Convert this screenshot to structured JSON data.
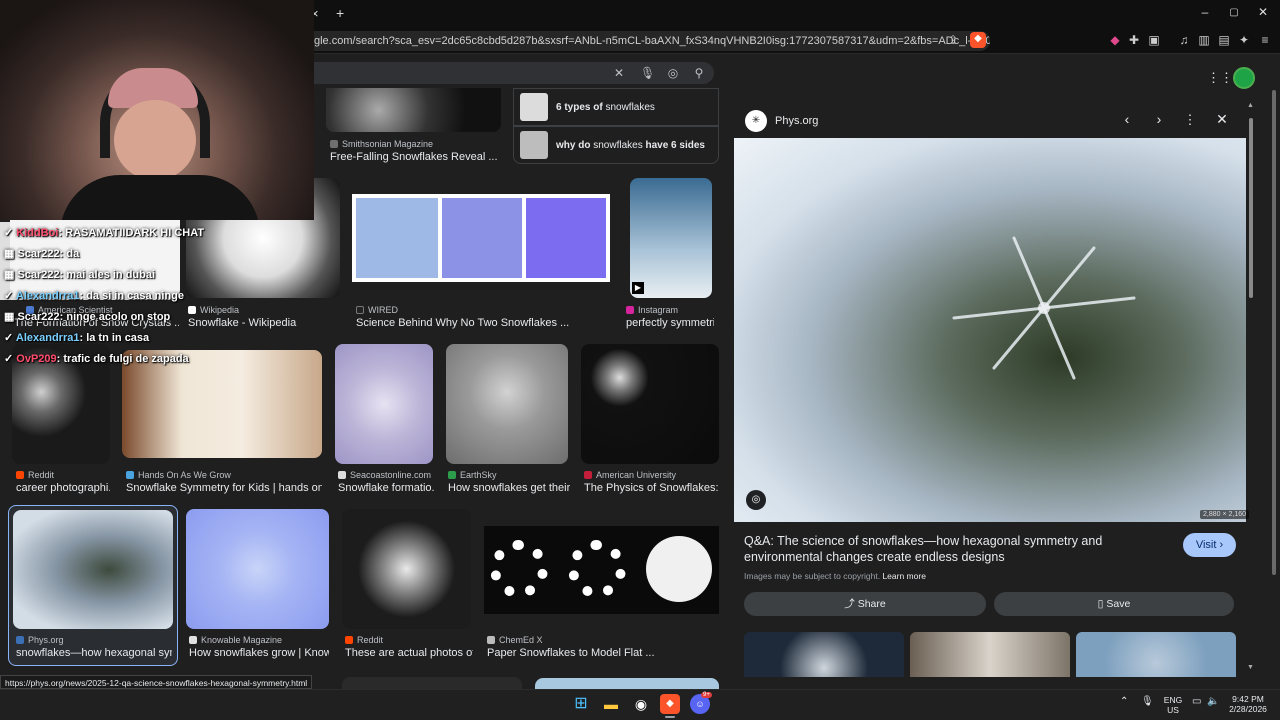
{
  "browser": {
    "tab_close": "×",
    "tab_new": "+",
    "url": "gle.com/search?sca_esv=2dc65c8cbd5d287b&sxsrf=ANbL-n5mCL-baAXN_fxS34nqVHNB2I0isg:1772307587317&udm=2&fbs=ADc_l-aN0CWEZBOHjof...",
    "window_controls": [
      "–",
      "▢",
      "✕"
    ]
  },
  "results": {
    "related": [
      {
        "bold_pre": "6 types of",
        "text": " snowflakes",
        "bold_post": ""
      },
      {
        "bold_pre": "why do",
        "text": " snowflakes ",
        "bold_post": "have 6 sides"
      }
    ],
    "items": [
      {
        "source": "Smithsonian Magazine",
        "caption": "Free-Falling Snowflakes Reveal ...",
        "fav": "#6f6f6f"
      },
      {
        "source": "American Scientist",
        "caption": "The Formation of Snow Crystals ...",
        "fav": "#4a7bd0"
      },
      {
        "source": "Wikipedia",
        "caption": "Snowflake - Wikipedia",
        "fav": "#ffffff"
      },
      {
        "source": "WIRED",
        "caption": "Science Behind Why No Two Snowflakes ...",
        "fav": "#222222"
      },
      {
        "source": "Instagram",
        "caption": "perfectly symmetri...",
        "fav": "#d6249f"
      },
      {
        "source": "Reddit",
        "caption": "career photographi...",
        "fav": "#ff4500"
      },
      {
        "source": "Hands On As We Grow",
        "caption": "Snowflake Symmetry for Kids | hands on ...",
        "fav": "#4aa3df"
      },
      {
        "source": "Seacoastonline.com",
        "caption": "Snowflake formatio...",
        "fav": "#dddddd"
      },
      {
        "source": "EarthSky",
        "caption": "How snowflakes get their...",
        "fav": "#2d9c4c"
      },
      {
        "source": "American University",
        "caption": "The Physics of Snowflakes: ...",
        "fav": "#c41e3a"
      },
      {
        "source": "Phys.org",
        "caption": "snowflakes—how hexagonal sym...",
        "fav": "#3b6fb6"
      },
      {
        "source": "Knowable Magazine",
        "caption": "How snowflakes grow | Know...",
        "fav": "#e0e0e0"
      },
      {
        "source": "Reddit",
        "caption": "These are actual photos of...",
        "fav": "#ff4500"
      },
      {
        "source": "ChemEd X",
        "caption": "Paper Snowflakes to Model Flat ...",
        "fav": "#bbbbbb"
      }
    ]
  },
  "chat": [
    {
      "user": "KiddBoi",
      "msg": ": RASAMATIIDARK HI CHAT",
      "ucolor": "#ff4d6d"
    },
    {
      "user": "Scar222",
      "msg": ": da",
      "ucolor": "#e8eaed"
    },
    {
      "user": "Scar222",
      "msg": ": mai ales in dubai",
      "ucolor": "#e8eaed"
    },
    {
      "user": "Alexandrra1",
      "msg": ": da si in casa ninge",
      "ucolor": "#7ad0ff"
    },
    {
      "user": "Scar222",
      "msg": ": ninge acolo on stop",
      "ucolor": "#e8eaed"
    },
    {
      "user": "Alexandrra1",
      "msg": ": la tn in casa",
      "ucolor": "#7ad0ff"
    },
    {
      "user": "OvP209",
      "msg": ": trafic de fulgi de zapada",
      "ucolor": "#ff4d6d"
    }
  ],
  "preview": {
    "site": "Phys.org",
    "dimensions": "2,880 × 2,160",
    "title": "Q&A: The science of snowflakes—how hexagonal symmetry and environmental changes create endless designs",
    "visit": "Visit",
    "copyright": "Images may be subject to copyright.",
    "learn_more": "Learn more",
    "share": "Share",
    "save": "Save"
  },
  "status_url": "https://phys.org/news/2025-12-qa-science-snowflakes-hexagonal-symmetry.html",
  "tray": {
    "lang": "ENG",
    "region": "US",
    "time": "9:42 PM",
    "date": "2/28/2026",
    "discord_badge": "9+"
  }
}
